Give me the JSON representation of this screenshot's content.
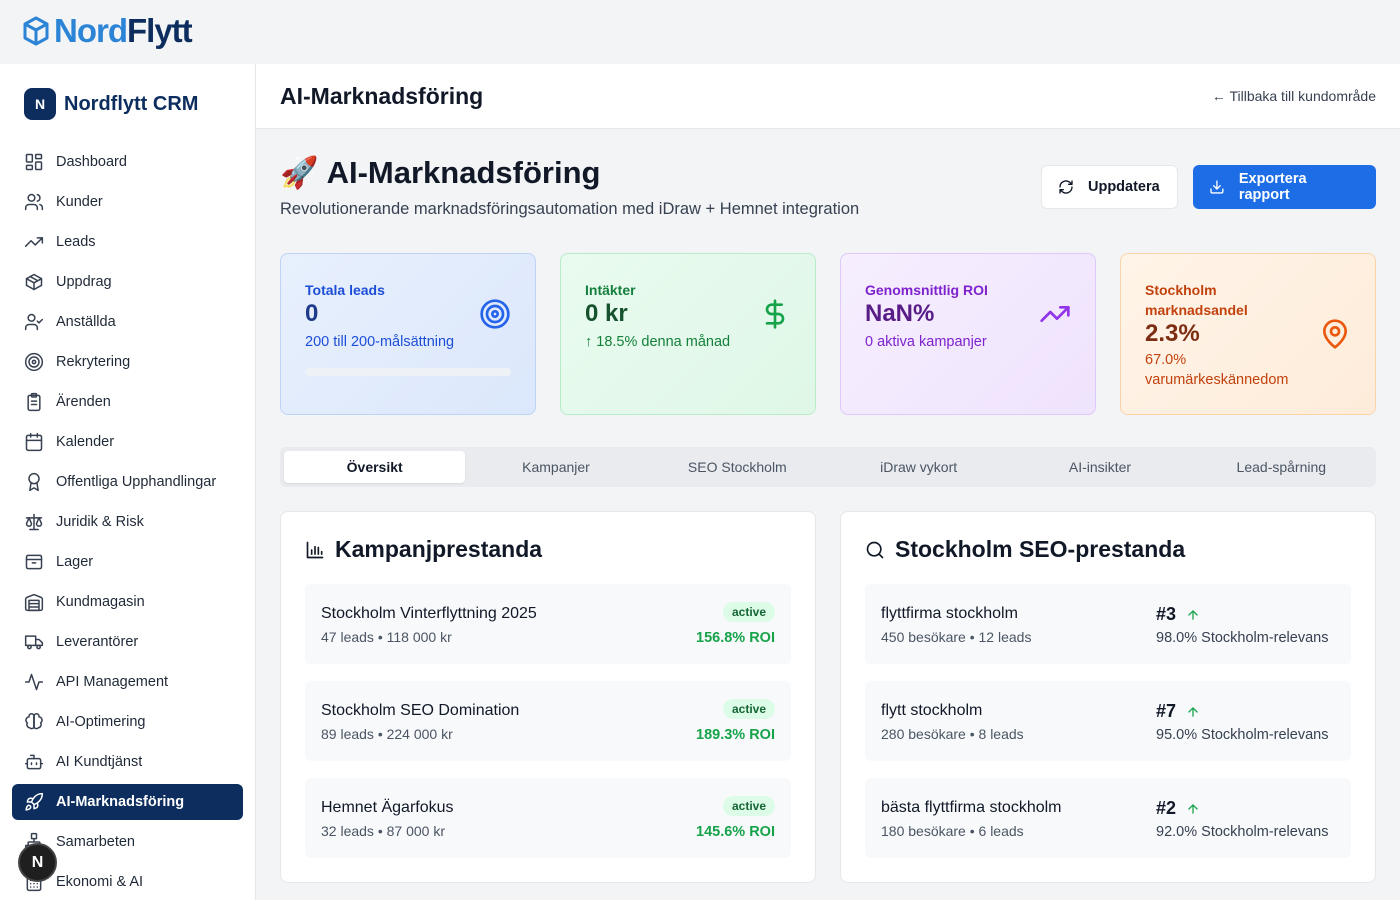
{
  "brand": {
    "part1": "Nord",
    "part2": "Flytt"
  },
  "sidebar": {
    "logo_letter": "N",
    "title": "Nordflytt CRM",
    "items": [
      {
        "label": "Dashboard",
        "icon": "layout-grid-icon"
      },
      {
        "label": "Kunder",
        "icon": "users-icon"
      },
      {
        "label": "Leads",
        "icon": "trending-up-icon"
      },
      {
        "label": "Uppdrag",
        "icon": "package-icon"
      },
      {
        "label": "Anställda",
        "icon": "user-check-icon"
      },
      {
        "label": "Rekrytering",
        "icon": "target-icon"
      },
      {
        "label": "Ärenden",
        "icon": "clipboard-icon"
      },
      {
        "label": "Kalender",
        "icon": "calendar-icon"
      },
      {
        "label": "Offentliga Upphandlingar",
        "icon": "award-icon"
      },
      {
        "label": "Juridik & Risk",
        "icon": "scale-icon"
      },
      {
        "label": "Lager",
        "icon": "box-icon"
      },
      {
        "label": "Kundmagasin",
        "icon": "warehouse-icon"
      },
      {
        "label": "Leverantörer",
        "icon": "truck-icon"
      },
      {
        "label": "API Management",
        "icon": "activity-icon"
      },
      {
        "label": "AI-Optimering",
        "icon": "brain-icon"
      },
      {
        "label": "AI Kundtjänst",
        "icon": "bot-icon"
      },
      {
        "label": "AI-Marknadsföring",
        "icon": "rocket-icon",
        "active": true
      },
      {
        "label": "Samarbeten",
        "icon": "network-icon"
      },
      {
        "label": "Ekonomi & AI",
        "icon": "calculator-icon"
      }
    ]
  },
  "fab_letter": "N",
  "header": {
    "title": "AI-Marknadsföring",
    "back_link": "← Tillbaka till kundområde"
  },
  "page": {
    "emoji": "🚀",
    "title": "AI-Marknadsföring",
    "subtitle": "Revolutionerande marknadsföringsautomation med iDraw + Hemnet integration",
    "update_label": "Uppdatera",
    "export_label": "Exportera rapport"
  },
  "stats": [
    {
      "label": "Totala leads",
      "value": "0",
      "sub": "200 till 200-målsättning",
      "icon": "target-icon",
      "progress": 0
    },
    {
      "label": "Intäkter",
      "value": "0 kr",
      "sub": "↑ 18.5% denna månad",
      "icon": "dollar-icon"
    },
    {
      "label": "Genomsnittlig ROI",
      "value": "NaN%",
      "sub": "0 aktiva kampanjer",
      "icon": "trending-up-icon"
    },
    {
      "label": "Stockholm marknadsandel",
      "value": "2.3%",
      "sub": "67.0% varumärkeskännedom",
      "icon": "map-pin-icon"
    }
  ],
  "tabs": [
    "Översikt",
    "Kampanjer",
    "SEO Stockholm",
    "iDraw vykort",
    "AI-insikter",
    "Lead-spårning"
  ],
  "campaigns": {
    "title": "Kampanjprestanda",
    "items": [
      {
        "name": "Stockholm Vinterflyttning 2025",
        "meta": "47 leads • 118 000 kr",
        "status": "active",
        "roi": "156.8% ROI"
      },
      {
        "name": "Stockholm SEO Domination",
        "meta": "89 leads • 224 000 kr",
        "status": "active",
        "roi": "189.3% ROI"
      },
      {
        "name": "Hemnet Ägarfokus",
        "meta": "32 leads • 87 000 kr",
        "status": "active",
        "roi": "145.6% ROI"
      }
    ]
  },
  "seo": {
    "title": "Stockholm SEO-prestanda",
    "items": [
      {
        "keyword": "flyttfirma stockholm",
        "meta": "450 besökare • 12 leads",
        "rank": "#3",
        "relevance": "98.0% Stockholm-relevans"
      },
      {
        "keyword": "flytt stockholm",
        "meta": "280 besökare • 8 leads",
        "rank": "#7",
        "relevance": "95.0% Stockholm-relevans"
      },
      {
        "keyword": "bästa flyttfirma stockholm",
        "meta": "180 besökare • 6 leads",
        "rank": "#2",
        "relevance": "92.0% Stockholm-relevans"
      }
    ]
  }
}
